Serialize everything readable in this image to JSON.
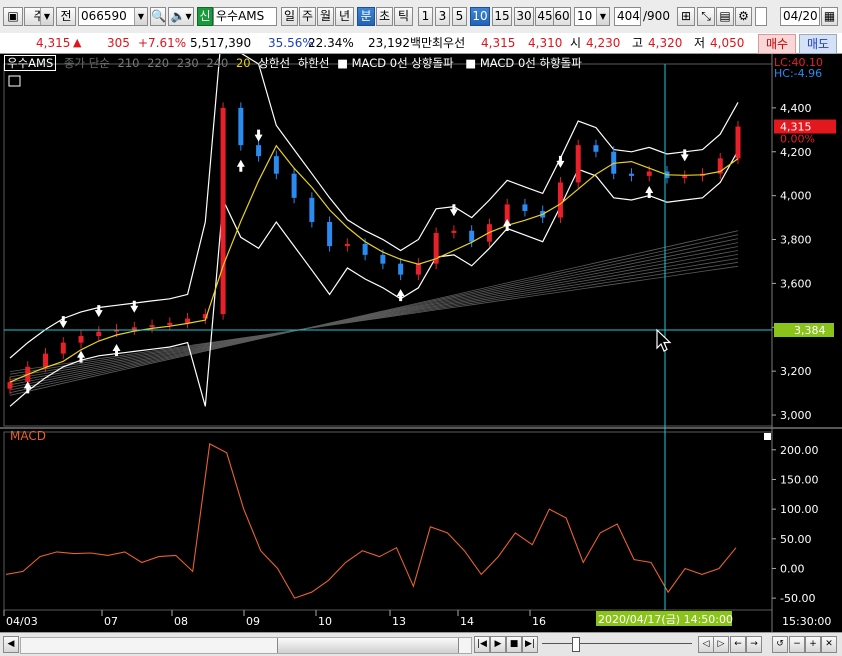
{
  "toolbar": {
    "menu_label": "주",
    "prev_label": "전",
    "code_value": "066590",
    "badge_label": "신",
    "stock_name": "우수AMS",
    "period_tabs": [
      "일",
      "주",
      "월",
      "년",
      "분",
      "초",
      "틱"
    ],
    "selected_period": "분",
    "minute_options": [
      "1",
      "3",
      "5",
      "10",
      "15",
      "30",
      "45",
      "60"
    ],
    "selected_minute": "10",
    "interval_value": "10",
    "count_value": "404",
    "count_total": "/900",
    "date_value": "04/20"
  },
  "quote": {
    "price": "4,315",
    "change": "305",
    "change_pct": "+7.61%",
    "volume": "5,517,390",
    "turnover_pct": "35.56%",
    "ratio_pct": "22.34%",
    "amount": "23,192백만",
    "priority_label": "최우선",
    "ask": "4,315",
    "bid": "4,310",
    "open_label": "시",
    "open": "4,230",
    "high_label": "고",
    "high": "4,320",
    "low_label": "저",
    "low": "4,050",
    "buy_label": "매수",
    "sell_label": "매도"
  },
  "legend": {
    "stock": "우수AMS",
    "ma": "종가 단순",
    "periods": [
      "210",
      "220",
      "230",
      "240"
    ],
    "p20": "20",
    "upper": "상한선",
    "lower": "하한선",
    "macd_up": "MACD 0선 상향돌파",
    "macd_down": "MACD 0선 하향돌파"
  },
  "corner": {
    "lc": "LC:40.10",
    "hc": "HC:-4.96",
    "last_price": "4,315",
    "last_pct": "0.00%",
    "crosshair_price": "3,384",
    "crosshair_time": "2020/04/17(금) 14:50:00",
    "now_time": "15:30:00"
  },
  "macd_label": "MACD",
  "colors": {
    "up": "#e8202a",
    "down": "#2a8bf0",
    "macd": "#e8622a",
    "ma20": "#e8d020",
    "band": "#ffffff",
    "cross": "#1fc8d8",
    "last_price_bg": "#e3171e",
    "cross_price_bg": "#8ac31a"
  },
  "chart_data": {
    "type": "line",
    "x": [
      "04/03",
      "07",
      "08",
      "09",
      "10",
      "13",
      "14",
      "16"
    ],
    "price_axis": {
      "ticks": [
        "4,400",
        "4,200",
        "4,000",
        "3,800",
        "3,600",
        "3,400",
        "3,200",
        "3,000"
      ],
      "ylim": [
        2950,
        4600
      ]
    },
    "macd_axis": {
      "ticks": [
        "200.00",
        "150.00",
        "100.00",
        "50.00",
        "0.00",
        "-50.00"
      ],
      "ylim": [
        -70,
        230
      ]
    },
    "series": [
      {
        "name": "MACD",
        "values": [
          -10,
          -5,
          20,
          28,
          25,
          26,
          22,
          28,
          10,
          20,
          22,
          -5,
          210,
          195,
          100,
          30,
          0,
          -50,
          -40,
          -20,
          10,
          30,
          20,
          35,
          -30,
          70,
          60,
          30,
          -10,
          20,
          60,
          40,
          100,
          85,
          10,
          60,
          75,
          15,
          10,
          -40,
          0,
          -10,
          0,
          35
        ]
      },
      {
        "name": "종가",
        "values": [
          3150,
          3220,
          3280,
          3330,
          3360,
          3380,
          3390,
          3400,
          3410,
          3420,
          3440,
          3460,
          4400,
          4230,
          4180,
          4100,
          3990,
          3880,
          3770,
          3780,
          3730,
          3690,
          3640,
          3690,
          3830,
          3840,
          3790,
          3870,
          3960,
          3930,
          3900,
          4060,
          4230,
          4200,
          4100,
          4090,
          4110,
          4080,
          4090,
          4100,
          4170,
          4315
        ]
      }
    ],
    "up_arrows": [
      1,
      4,
      6,
      13,
      22,
      28,
      36
    ],
    "down_arrows": [
      3,
      5,
      7,
      14,
      25,
      31,
      38
    ]
  }
}
